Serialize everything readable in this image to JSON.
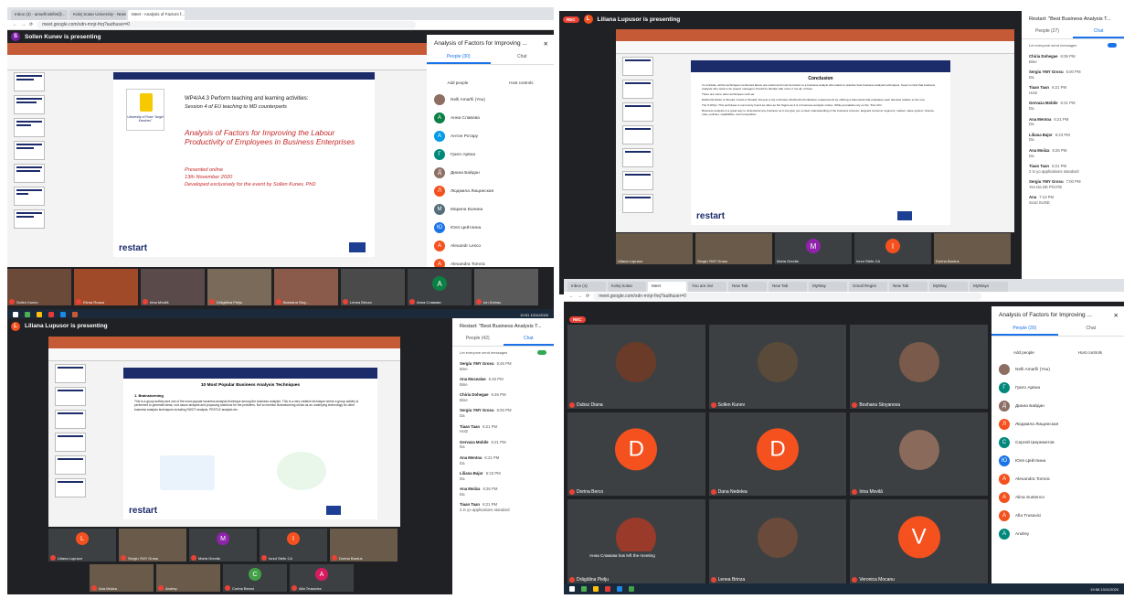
{
  "q1": {
    "tabs": [
      "Inbox (3) - amarfinskifet@...",
      "Kolej Sotan University - News Ro...",
      "Meet - Analysis of Factors f..."
    ],
    "url": "meet.google.com/xdn-mnjr-fnq?authuser=0",
    "presenting": "Sollen Kunev is presenting",
    "presenter_initial": "S",
    "slide": {
      "logo_text": "University of Ruse \"Angel Kanchev\"",
      "wp_title": "WP4/A4.3 Perform teaching and learning activities:",
      "session": "Session 4 of  EU teaching to MD counterparts",
      "main_title": "Analysis of Factors for Improving the Labour Productivity of Employees in Business Enterprises",
      "presented": "Presented online",
      "date": "13th November 2020",
      "developed": "Developed exclusively for the event by Sollen Kunev, PhD",
      "brand": "restart"
    },
    "panel": {
      "title": "Analysis of Factors for Improving ...",
      "tab_people": "People (30)",
      "tab_chat": "Chat",
      "add_people": "Add people",
      "host_controls": "Host controls",
      "people": [
        {
          "name": "Nelli Amarfii (You)",
          "initial": "",
          "color": "#8d6e63"
        },
        {
          "name": "Анна Славова",
          "initial": "А",
          "color": "#0b8043"
        },
        {
          "name": "Антон Ротару",
          "initial": "А",
          "color": "#039be5"
        },
        {
          "name": "Григо Арвна",
          "initial": "Г",
          "color": "#00897b"
        },
        {
          "name": "Диана Байдан",
          "initial": "Д",
          "color": "#8d6e63"
        },
        {
          "name": "Людмила Лищинская",
          "initial": "Л",
          "color": "#f4511e"
        },
        {
          "name": "Марина Болина",
          "initial": "М",
          "color": "#546e7a"
        },
        {
          "name": "Юля Цейтлина",
          "initial": "Ю",
          "color": "#1a73e8"
        },
        {
          "name": "Alexandr Lesco",
          "initial": "A",
          "color": "#f4511e"
        },
        {
          "name": "Alexandra Tomnic",
          "initial": "A",
          "color": "#f4511e"
        }
      ]
    },
    "strip": [
      "Sollen Kunev",
      "Elena Roaca",
      "Irina Movilă",
      "Drăgălina Pielju",
      "Boshana Stoy...",
      "Lenea Brinza",
      "Анна Славова",
      "Ion Sobrac"
    ],
    "strip_initials": [
      "",
      "",
      "",
      "",
      "",
      "",
      "А",
      ""
    ]
  },
  "q2": {
    "rec": "REC",
    "presenting": "Liliana Lupusor is presenting",
    "presenter_initial": "L",
    "slide": {
      "heading": "Conclusion",
      "para1": "In conclude, all the techniques mentioned above are useful and must be known to a business analyst who wants to practice best business analysis techniques. Keep in mind that business analysts who want to be project managers should be familiar with most, if not all, of them.",
      "para2": "There are some other techniques such as:",
      "para3": "MoSCoW (Must or Should, Could or Would): Not just a city in Russia, MoSCoW prioritization requirements by offering a framework that evaluates each demand relative to the rest.",
      "para4": "The 5 Whys: This technique is commonly found as often as Six Sigma as it is in business analysis circles. While journalists rely on the \"Five Ws\".",
      "para5": "Business analysis is a great way to understand any business as it can give you a clear understanding of the business process, targeted customer segment, market, value system, finance rules, policies, capabilities, and competition.",
      "brand": "restart"
    },
    "panel": {
      "title": "Restart: \"Best Business Analysis T...",
      "tab_people": "People (27)",
      "tab_chat": "Chat",
      "toggle_label": "Let everyone send messages",
      "messages": [
        {
          "name": "Chiria Dohegae",
          "time": "6:06 PM",
          "text": "Bine"
        },
        {
          "name": "Sergiu YMY Grosu",
          "time": "6:00 PM",
          "text": "Da"
        },
        {
          "name": "Tiaan Taan",
          "time": "6:21 PM",
          "text": "Hot2"
        },
        {
          "name": "Gervaza Mobile",
          "time": "6:21 PM",
          "text": "Da"
        },
        {
          "name": "Ana Mentoa",
          "time": "6:21 PM",
          "text": "Da"
        },
        {
          "name": "Liliana Bajor",
          "time": "6:23 PM",
          "text": "Da"
        },
        {
          "name": "Ana Moiiza",
          "time": "6:26 PM",
          "text": "Da"
        },
        {
          "name": "Tiaan Taan",
          "time": "6:21 PM",
          "text": "2 in yo applications standard"
        },
        {
          "name": "Sergiu YMY Grosu",
          "time": "7:00 PM",
          "text": "Yes Da DE POATE"
        },
        {
          "name": "Ana",
          "time": "7:13 PM",
          "text": "Scuti SUGE"
        }
      ]
    },
    "strip": [
      {
        "name": "Liliana Lupusor",
        "initial": ""
      },
      {
        "name": "Sergiu YMY Grosu",
        "initial": ""
      },
      {
        "name": "Maria Grecila",
        "initial": "M"
      },
      {
        "name": "Ionut Stefu CA",
        "initial": "I"
      },
      {
        "name": "Dorina Bardus",
        "initial": ""
      }
    ]
  },
  "q3": {
    "presenting": "Liliana Lupusor is presenting",
    "presenter_initial": "L",
    "slide": {
      "heading": "10 Most Popular Business Analysis Techniques",
      "subheading": "1. Brainstorming",
      "body": "This is a group activity and one of the most popular business analysis technique among the business analysts. This is a very creative technique where a group activity is performed to generate ideas, root cause analysis and proposing solutions for the problems. Not to mention Brainstorming works as an underlying technology for other business analysis techniques including SWOT analysis, PESTLE analysis etc.",
      "brand": "restart"
    },
    "panel": {
      "title": "Restart: \"Best Business Analysis T...",
      "tab_people": "People (42)",
      "tab_chat": "Chat",
      "toggle_label": "Let everyone send messages",
      "messages": [
        {
          "name": "Sergiu YMY Grosu",
          "time": "5:46 PM",
          "text": "Bine"
        },
        {
          "name": "Ana Mocealae",
          "time": "5:46 PM",
          "text": "Bine"
        },
        {
          "name": "Chiria Dohegae",
          "time": "5:46 PM",
          "text": "Bine"
        },
        {
          "name": "Sergiu YMY Grosu",
          "time": "6:00 PM",
          "text": "Da"
        },
        {
          "name": "Tiaan Taan",
          "time": "6:21 PM",
          "text": "Hot2"
        },
        {
          "name": "Gervaza Mobile",
          "time": "6:21 PM",
          "text": "Da"
        },
        {
          "name": "Ana Mentoa",
          "time": "6:21 PM",
          "text": "Da"
        },
        {
          "name": "Liliana Bajor",
          "time": "6:23 PM",
          "text": "Da"
        },
        {
          "name": "Ana Moiiza",
          "time": "6:26 PM",
          "text": "Da"
        },
        {
          "name": "Tiaan Taan",
          "time": "6:21 PM",
          "text": "2 in yo applications standard"
        }
      ]
    },
    "strip": [
      {
        "name": "Liliana Lupusor",
        "initial": "L",
        "color": "#f4511e"
      },
      {
        "name": "Sergiu YMY Grosu",
        "initial": "",
        "color": ""
      },
      {
        "name": "Maria Grecila",
        "initial": "M",
        "color": "#8e24aa"
      },
      {
        "name": "Ionut Stefu CA",
        "initial": "I",
        "color": "#f4511e"
      },
      {
        "name": "Dorina Bardus",
        "initial": "",
        "color": ""
      }
    ],
    "strip2": [
      {
        "name": "Ana Moiiza",
        "initial": "",
        "color": ""
      },
      {
        "name": "Andrey",
        "initial": "",
        "color": ""
      },
      {
        "name": "Corina Berzul",
        "initial": "C",
        "color": "#43a047"
      },
      {
        "name": "Alla Trusavics",
        "initial": "A",
        "color": "#d81b60"
      }
    ]
  },
  "q4": {
    "tabs": [
      "Inbox (4)",
      "Kolej Sotan",
      "Meet",
      "You are invi",
      "New Tab",
      "New Tab",
      "MyWay",
      "Gmail Regist",
      "New Tab",
      "MyWay",
      "MyWays"
    ],
    "url": "meet.google.com/xdn-mnjr-fnq?authuser=0",
    "rec": "REC",
    "panel": {
      "title": "Analysis of Factors for Improving ...",
      "tab_people": "People (30)",
      "tab_chat": "Chat",
      "add_people": "Add people",
      "host_controls": "Host controls",
      "people": [
        {
          "name": "Nelli Amarfii (You)",
          "initial": "",
          "color": "#8d6e63"
        },
        {
          "name": "Григо Арвна",
          "initial": "Г",
          "color": "#00897b"
        },
        {
          "name": "Диана Байдан",
          "initial": "Д",
          "color": "#8d6e63"
        },
        {
          "name": "Людмила Лищинская",
          "initial": "Л",
          "color": "#f4511e"
        },
        {
          "name": "Сергей Шереметов",
          "initial": "С",
          "color": "#00897b"
        },
        {
          "name": "Юля Цейтлина",
          "initial": "Ю",
          "color": "#1a73e8"
        },
        {
          "name": "Alexandra Tomnic",
          "initial": "A",
          "color": "#f4511e"
        },
        {
          "name": "Alina Sustenco",
          "initial": "A",
          "color": "#f4511e"
        },
        {
          "name": "Alla Trusavici",
          "initial": "A",
          "color": "#f4511e"
        },
        {
          "name": "Andrey",
          "initial": "A",
          "color": "#00897b"
        }
      ]
    },
    "tiles": [
      {
        "name": "Dubsz Diana",
        "initial": "",
        "color": "#6b3b2a"
      },
      {
        "name": "Sollen Kunev",
        "initial": "",
        "color": "#5a4a3a"
      },
      {
        "name": "Boshana Stoyanova",
        "initial": "",
        "color": "#7a5a4a"
      },
      {
        "name": "Dorina Berco",
        "initial": "D",
        "color": "#f4511e"
      },
      {
        "name": "Dana Nedelea",
        "initial": "D",
        "color": "#f4511e"
      },
      {
        "name": "Irina Movilă",
        "initial": "",
        "color": "#8a6a5a"
      },
      {
        "name": "Drăgălina Pielju",
        "initial": "",
        "color": "#9a3a2a"
      },
      {
        "name": "Lenea Brinza",
        "initial": "",
        "color": "#6a4a3a"
      },
      {
        "name": "Veronica Mocanu",
        "initial": "V",
        "color": "#f4511e"
      }
    ],
    "toast": "Анна Славова has left the meeting"
  },
  "taskbar": {
    "clock1": "19:51 13/11/2020",
    "clock2": "19:58 13/11/2020"
  }
}
